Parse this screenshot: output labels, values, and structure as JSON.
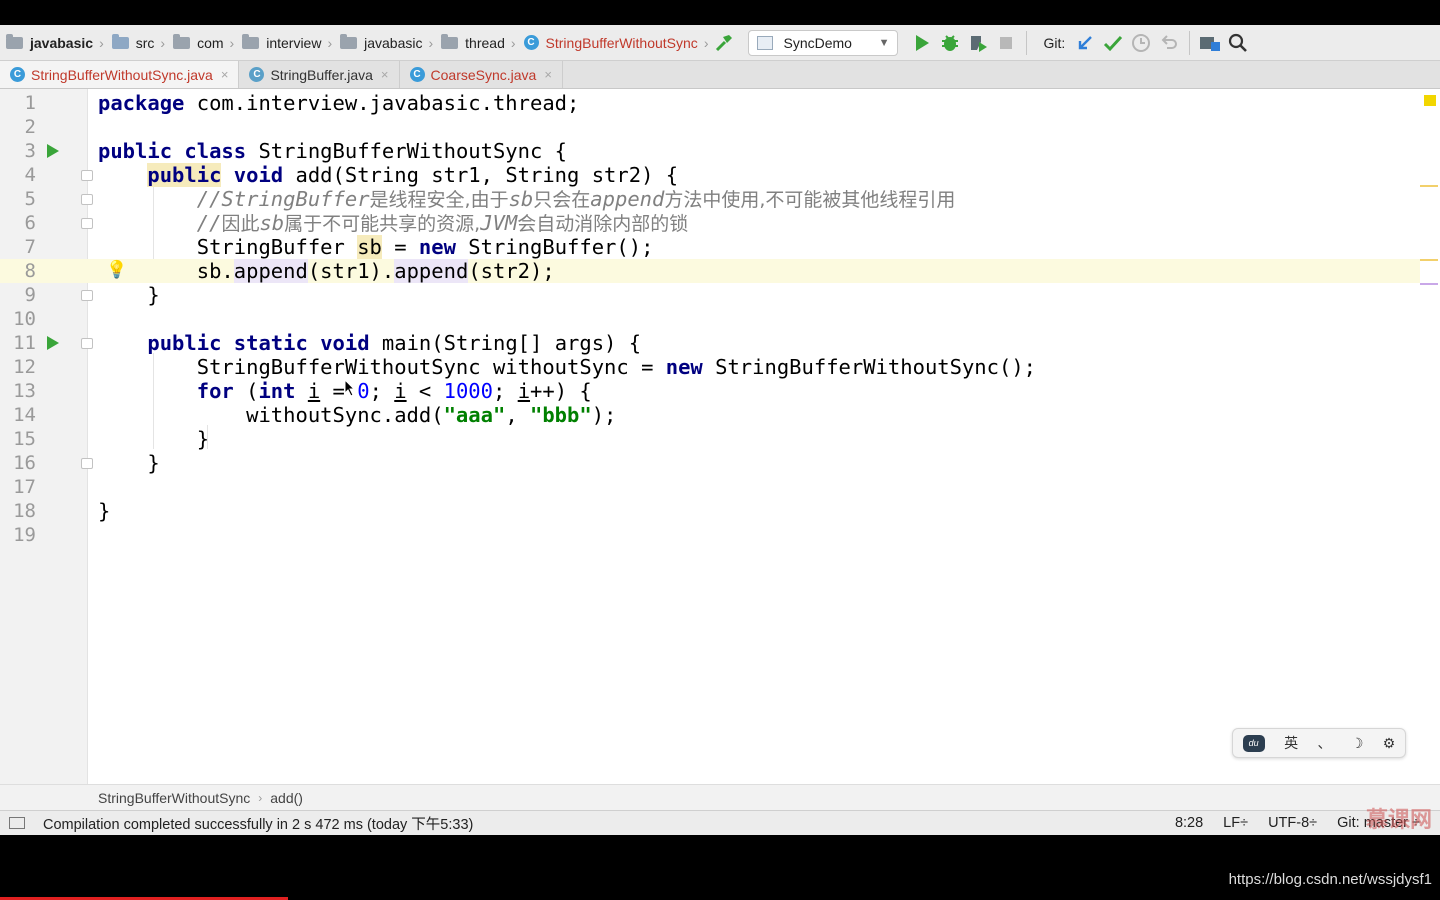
{
  "navbar": {
    "crumbs": [
      "javabasic",
      "src",
      "com",
      "interview",
      "javabasic",
      "thread",
      "StringBufferWithoutSync"
    ],
    "run_config": "SyncDemo",
    "git_label": "Git:"
  },
  "tabs": [
    {
      "label": "StringBufferWithoutSync.java",
      "close": "×"
    },
    {
      "label": "StringBuffer.java",
      "close": "×"
    },
    {
      "label": "CoarseSync.java",
      "close": "×"
    }
  ],
  "editor": {
    "line_numbers": [
      "1",
      "2",
      "3",
      "4",
      "5",
      "6",
      "7",
      "8",
      "9",
      "10",
      "11",
      "12",
      "13",
      "14",
      "15",
      "16",
      "17",
      "18",
      "19"
    ],
    "code": {
      "l1a": "package",
      "l1b": " com.interview.javabasic.thread;",
      "l3a": "public",
      "l3b": "class",
      "l3c": " StringBufferWithoutSync {",
      "l4a": "public",
      "l4b": "void",
      "l4c": " add(String str1, String str2) {",
      "l5a": "//StringBuffer",
      "l5b": "是线程安全,由于",
      "l5c": "sb",
      "l5d": "只会在",
      "l5e": "append",
      "l5f": "方法中使用,不可能被其他线程引用",
      "l6a": "//",
      "l6b": "因此",
      "l6c": "sb",
      "l6d": "属于不可能共享的资源,",
      "l6e": "JVM",
      "l6f": "会自动消除内部的锁",
      "l7a": "StringBuffer ",
      "l7b": "sb",
      "l7c": " = ",
      "l7d": "new",
      "l7e": " StringBuffer();",
      "l8a": "sb.",
      "l8b": "append",
      "l8c": "(str1).",
      "l8d": "append",
      "l8e": "(str2);",
      "l9": "}",
      "l11a": "public",
      "l11b": "static",
      "l11c": "void",
      "l11d": " main(String[] args) {",
      "l12a": "StringBufferWithoutSync withoutSync = ",
      "l12b": "new",
      "l12c": " StringBufferWithoutSync();",
      "l13a": "for",
      "l13b": " (",
      "l13c": "int",
      "l13d": " ",
      "l13e": "i",
      "l13f": " = ",
      "l13g": "0",
      "l13h": "; ",
      "l13i": "i",
      "l13j": " < ",
      "l13k": "1000",
      "l13l": "; ",
      "l13m": "i",
      "l13n": "++) {",
      "l14a": "withoutSync.add(",
      "l14b": "\"aaa\"",
      "l14c": ", ",
      "l14d": "\"bbb\"",
      "l14e": ");",
      "l15": "}",
      "l16": "}",
      "l18": "}"
    }
  },
  "ime": {
    "du": "du",
    "lang": "英",
    "punct": "、",
    "moon": "☽",
    "gear": "⚙"
  },
  "codecrumb": {
    "cls": "StringBufferWithoutSync",
    "sep": "›",
    "method": "add()"
  },
  "status": {
    "message": "Compilation completed successfully in 2 s 472 ms (today 下午5:33)",
    "position": "8:28",
    "line_sep": "LF÷",
    "encoding": "UTF-8÷",
    "git": "Git: master ÷"
  },
  "watermark": "慕课网",
  "url": "https://blog.csdn.net/wssjdysf1",
  "colors": {
    "keyword": "#000080",
    "string": "#008000",
    "number": "#0000ff",
    "comment": "#808080",
    "active_tab": "#c0392b",
    "run_green": "#3aa53a"
  }
}
